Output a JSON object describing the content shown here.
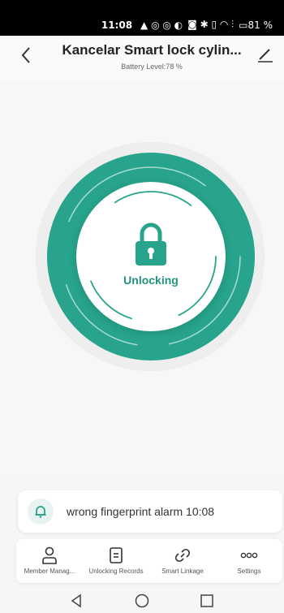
{
  "status_bar": {
    "time": "11:08",
    "left_icons": "▲ ◎ ◎ ◐",
    "right_icons": "◙ ✱ ▯ ◠ ⫶",
    "battery": "▭81 %"
  },
  "header": {
    "title": "Kancelar Smart lock cylin...",
    "battery_level": "Battery Level:78 %"
  },
  "lock": {
    "status_label": "Unlocking",
    "icon": "padlock-icon",
    "accent_color": "#27a48b"
  },
  "alarm": {
    "text": "wrong fingerprint alarm 10:08",
    "icon": "bell-icon"
  },
  "bottom_nav": {
    "items": [
      {
        "label": "Member Manag...",
        "icon": "person-icon"
      },
      {
        "label": "Unlocking Records",
        "icon": "document-icon"
      },
      {
        "label": "Smart Linkage",
        "icon": "link-icon"
      },
      {
        "label": "Settings",
        "icon": "more-icon"
      }
    ]
  },
  "system_nav": {
    "buttons": [
      "back-triangle-icon",
      "home-circle-icon",
      "recents-square-icon"
    ]
  }
}
